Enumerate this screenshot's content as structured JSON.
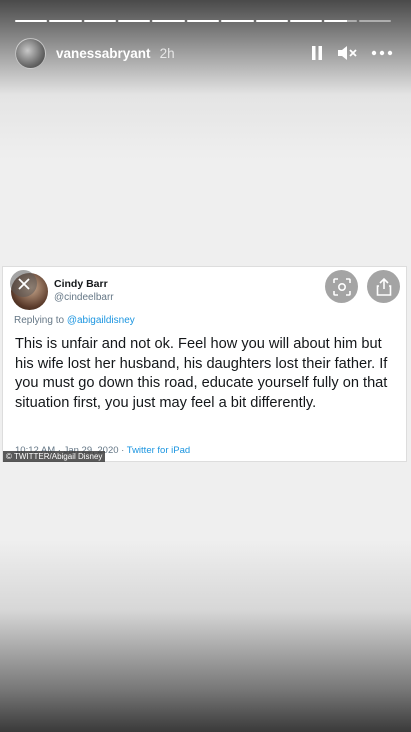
{
  "story": {
    "progress_segments": [
      1,
      1,
      1,
      1,
      1,
      1,
      1,
      1,
      1,
      0.7,
      0
    ],
    "username": "vanessabryant",
    "time": "2h"
  },
  "icons": {
    "pause": "pause-icon",
    "mute": "muted-speaker-icon",
    "more": "more-horizontal-icon",
    "close": "close-icon",
    "lens": "visual-search-icon",
    "share": "share-icon"
  },
  "tweet": {
    "name": "Cindy Barr",
    "handle": "@cindeelbarr",
    "replying_prefix": "Replying to",
    "replying_to": "@abigaildisney",
    "body": "This is unfair and not ok.  Feel how you will about him but his wife lost her husband, his daughters lost their father.  If you must go down this road, educate yourself fully on that situation first, you just may feel a bit differently.",
    "timestamp": "10:12 AM · Jan 29, 2020 · ",
    "client": "Twitter for iPad",
    "credit": "© TWITTER/Abigail Disney"
  },
  "colors": {
    "link": "#1b95e0",
    "text": "#14171a",
    "muted": "#657786"
  }
}
